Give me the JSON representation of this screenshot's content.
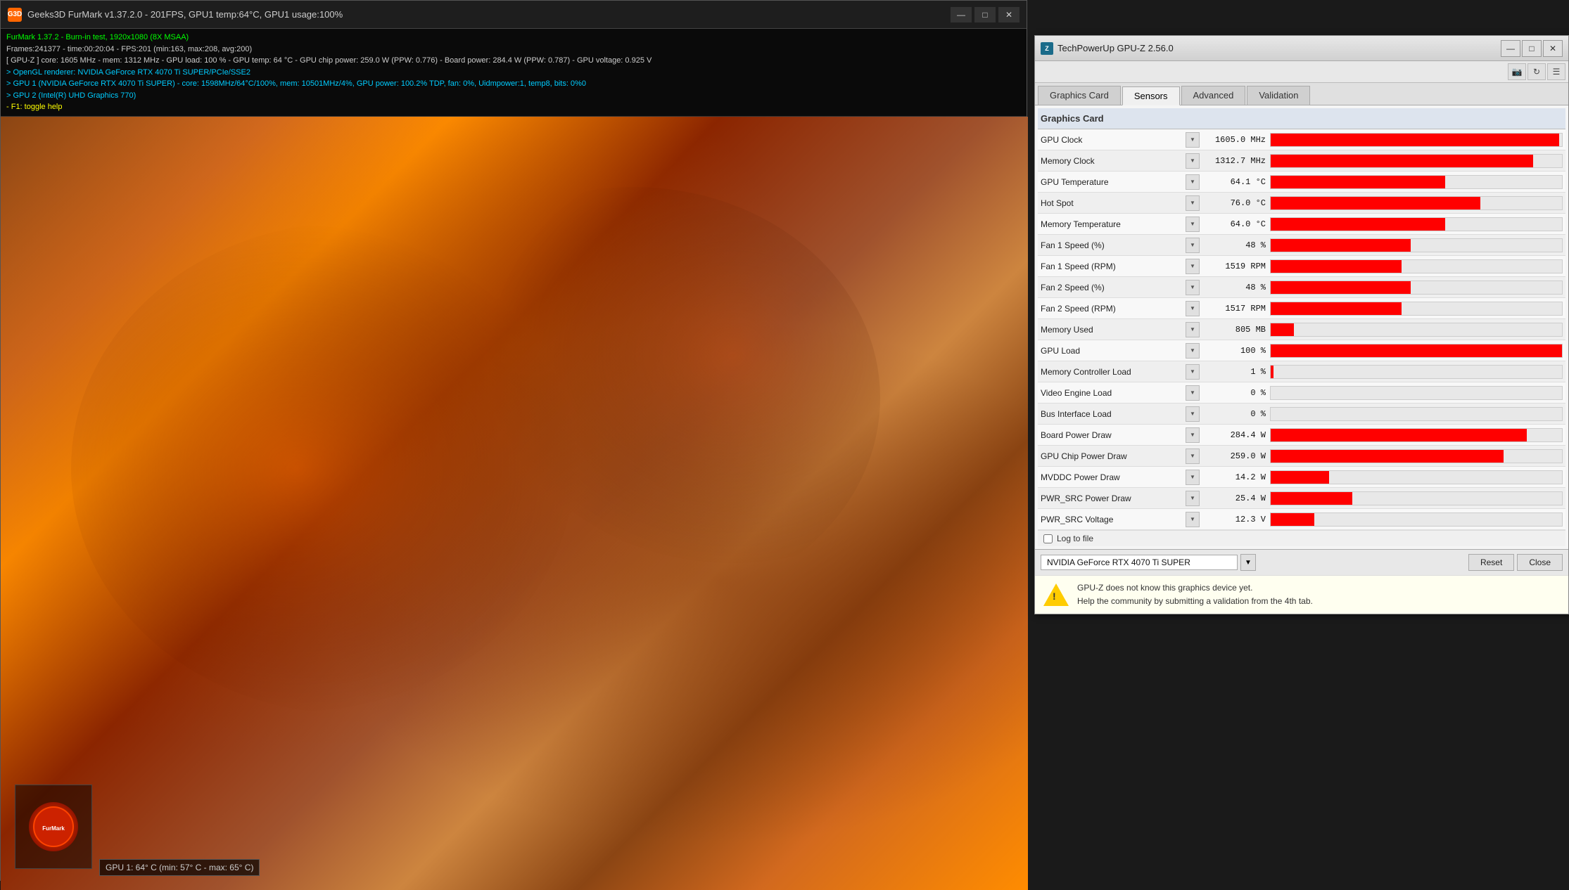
{
  "furmark": {
    "title": "Geeks3D FurMark v1.37.2.0 - 201FPS, GPU1 temp:64°C, GPU1 usage:100%",
    "info_lines": [
      "FurMark 1.37.2 - Burn-in test, 1920x1080 (8X MSAA)",
      "Frames:241377 - time:00:20:04 - FPS:201 (min:163, max:208, avg:200)",
      "[ GPU-Z ] core: 1605 MHz - mem: 1312 MHz - GPU load: 100 % - GPU temp: 64 °C - GPU chip power: 259.0 W (PPW: 0.776) - Board power: 284.4 W (PPW: 0.787) - GPU voltage: 0.925 V",
      "> OpenGL renderer: NVIDIA GeForce RTX 4070 Ti SUPER/PCIe/SSE2",
      "> GPU 1 (NVIDIA GeForce RTX 4070 Ti SUPER) - core: 1598MHz/64°C/100%, mem: 10501MHz/4%, GPU power: 100.2% TDP, fan: 0%, Uidmpower:1, temp8, bits: 0%0",
      "> GPU 2 (Intel(R) UHD Graphics 770)",
      "- F1: toggle help"
    ],
    "gpu_temp_label": "GPU 1: 64° C (min: 57° C - max: 65° C)",
    "window_controls": {
      "minimize": "—",
      "maximize": "□",
      "close": "✕"
    }
  },
  "gpuz": {
    "title": "TechPowerUp GPU-Z 2.56.0",
    "tabs": [
      "Graphics Card",
      "Sensors",
      "Advanced",
      "Validation"
    ],
    "active_tab": "Sensors",
    "toolbar_icons": [
      "camera",
      "refresh",
      "menu"
    ],
    "section_header": "Graphics Card",
    "sensors": [
      {
        "label": "GPU Clock",
        "value": "1605.0 MHz",
        "bar_pct": 99,
        "has_bar": true
      },
      {
        "label": "Memory Clock",
        "value": "1312.7 MHz",
        "bar_pct": 90,
        "has_bar": true
      },
      {
        "label": "GPU Temperature",
        "value": "64.1 °C",
        "bar_pct": 60,
        "has_bar": true
      },
      {
        "label": "Hot Spot",
        "value": "76.0 °C",
        "bar_pct": 72,
        "has_bar": true
      },
      {
        "label": "Memory Temperature",
        "value": "64.0 °C",
        "bar_pct": 60,
        "has_bar": true
      },
      {
        "label": "Fan 1 Speed (%)",
        "value": "48 %",
        "bar_pct": 48,
        "has_bar": true
      },
      {
        "label": "Fan 1 Speed (RPM)",
        "value": "1519 RPM",
        "bar_pct": 45,
        "has_bar": true
      },
      {
        "label": "Fan 2 Speed (%)",
        "value": "48 %",
        "bar_pct": 48,
        "has_bar": true
      },
      {
        "label": "Fan 2 Speed (RPM)",
        "value": "1517 RPM",
        "bar_pct": 45,
        "has_bar": true
      },
      {
        "label": "Memory Used",
        "value": "805 MB",
        "bar_pct": 8,
        "has_bar": true
      },
      {
        "label": "GPU Load",
        "value": "100 %",
        "bar_pct": 100,
        "has_bar": true
      },
      {
        "label": "Memory Controller Load",
        "value": "1 %",
        "bar_pct": 1,
        "has_bar": true
      },
      {
        "label": "Video Engine Load",
        "value": "0 %",
        "bar_pct": 0,
        "has_bar": true
      },
      {
        "label": "Bus Interface Load",
        "value": "0 %",
        "bar_pct": 0,
        "has_bar": true
      },
      {
        "label": "Board Power Draw",
        "value": "284.4 W",
        "bar_pct": 88,
        "has_bar": true
      },
      {
        "label": "GPU Chip Power Draw",
        "value": "259.0 W",
        "bar_pct": 80,
        "has_bar": true
      },
      {
        "label": "MVDDC Power Draw",
        "value": "14.2 W",
        "bar_pct": 20,
        "has_bar": true
      },
      {
        "label": "PWR_SRC Power Draw",
        "value": "25.4 W",
        "bar_pct": 28,
        "has_bar": true
      },
      {
        "label": "PWR_SRC Voltage",
        "value": "12.3 V",
        "bar_pct": 15,
        "has_bar": true
      }
    ],
    "log_to_file_label": "Log to file",
    "gpu_name": "NVIDIA GeForce RTX 4070 Ti SUPER",
    "footer_buttons": {
      "reset": "Reset",
      "close": "Close"
    },
    "notification": {
      "text_line1": "GPU-Z does not know this graphics device yet.",
      "text_line2": "Help the community by submitting a validation from the 4th tab."
    },
    "window_controls": {
      "minimize": "—",
      "maximize": "□",
      "close": "✕"
    }
  }
}
